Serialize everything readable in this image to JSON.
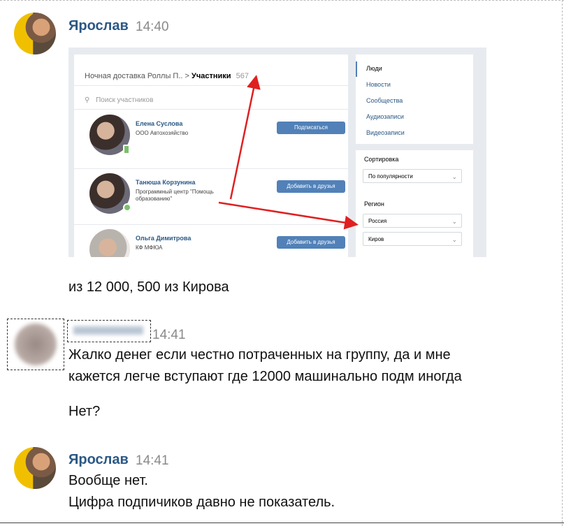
{
  "messages": [
    {
      "author": "Ярослав",
      "time": "14:40",
      "lines": [
        "из 12 000, 500 из Кирова"
      ]
    },
    {
      "author": "",
      "time": "14:41",
      "lines": [
        "Жалко денег если честно потраченных на группу, да и мне",
        "кажется легче вступают где 12000 машинально подм иногда",
        "Нет?"
      ]
    },
    {
      "author": "Ярослав",
      "time": "14:41",
      "lines": [
        "Вообще нет.",
        "Цифра подпичиков давно не показатель."
      ]
    }
  ],
  "screenshot": {
    "breadcrumb_group": "Ночная доставка Роллы П..",
    "breadcrumb_sep": ">",
    "breadcrumb_current": "Участники",
    "member_count": "567",
    "search_placeholder": "Поиск участников",
    "people": [
      {
        "name": "Елена Суслова",
        "org": "ООО Автохозяйство",
        "button": "Подписаться"
      },
      {
        "name": "Танюша Корзунина",
        "org": "Программный центр \"Помощь образованию\"",
        "button": "Добавить в друзья"
      },
      {
        "name": "Ольга Димитрова",
        "org": "КФ МФЮА",
        "button": "Добавить в друзья"
      }
    ],
    "menu": [
      "Люди",
      "Новости",
      "Сообщества",
      "Аудиозаписи",
      "Видеозаписи"
    ],
    "sort_label": "Сортировка",
    "sort_value": "По популярности",
    "region_label": "Регион",
    "country_value": "Россия",
    "city_value": "Киров"
  },
  "colors": {
    "author": "#2a5885",
    "button": "#5181b8",
    "arrow": "#e02020"
  },
  "icons": {
    "search": "search-icon",
    "chevron": "chevron-down-icon"
  }
}
